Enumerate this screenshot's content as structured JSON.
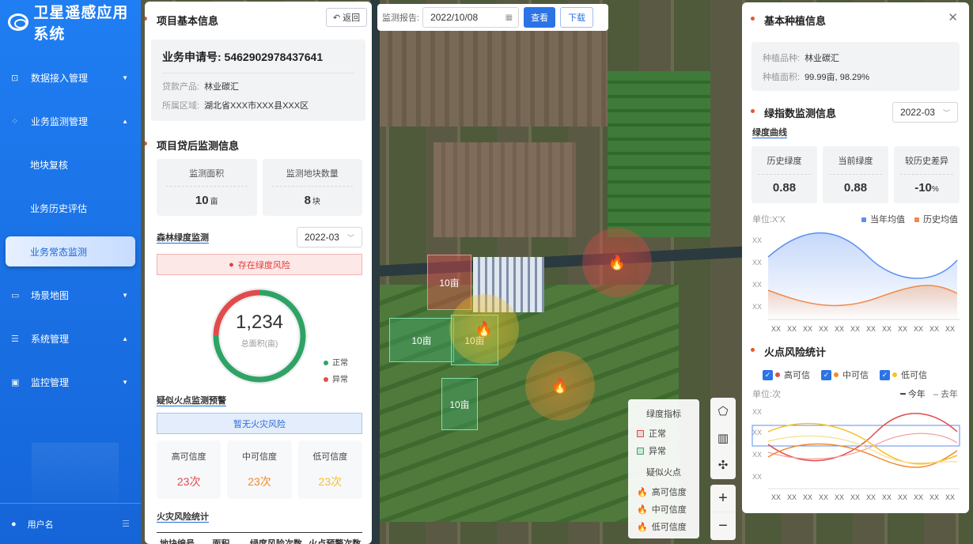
{
  "app": {
    "title": "卫星遥感应用系统"
  },
  "sidebar": {
    "items": [
      {
        "label": "数据接入管理",
        "icon": "data-import-icon",
        "caret": "▼"
      },
      {
        "label": "业务监测管理",
        "icon": "grid-icon",
        "caret": "▲"
      }
    ],
    "sub": [
      "地块复核",
      "业务历史评估",
      "业务常态监测"
    ],
    "items2": [
      {
        "label": "场景地图",
        "icon": "map-icon",
        "caret": "▼"
      },
      {
        "label": "系统管理",
        "icon": "settings-icon",
        "caret": "▲"
      },
      {
        "label": "监控管理",
        "icon": "monitor-icon",
        "caret": "▼"
      }
    ],
    "user": "用户名"
  },
  "topbar": {
    "label": "监测报告:",
    "date": "2022/10/08",
    "view_btn": "查看",
    "download_btn": "下载"
  },
  "left": {
    "title": "项目基本信息",
    "back": "返回",
    "app_no": "业务申请号: 5462902978437641",
    "product_label": "贷款产品:",
    "product": "林业碳汇",
    "region_label": "所属区域:",
    "region": "湖北省XXX市XXX县XXX区",
    "monitor_title": "项目贷后监测信息",
    "area_label": "监测面积",
    "area_value": "10",
    "area_unit": "亩",
    "count_label": "监测地块数量",
    "count_value": "8",
    "count_unit": "块",
    "forest_title": "森林绿度监测",
    "forest_month": "2022-03",
    "risk_alert": "存在绿度风险",
    "donut_value": "1,234",
    "donut_label": "总面积(亩)",
    "legend_normal": "正常",
    "legend_abnormal": "异常",
    "fire_title": "疑似火点监测预警",
    "fire_alert": "暂无火灾风险",
    "conf": [
      {
        "label": "高可信度",
        "value": "23次",
        "color": "#e14b4b"
      },
      {
        "label": "中可信度",
        "value": "23次",
        "color": "#f08a2f"
      },
      {
        "label": "低可信度",
        "value": "23次",
        "color": "#f5c22b"
      }
    ],
    "fire_stats_title": "火灾风险统计",
    "table_headers": [
      "地块编号",
      "面积",
      "绿度风险次数",
      "火点预警次数"
    ]
  },
  "right": {
    "title": "基本种植信息",
    "crop_label": "种植品种:",
    "crop": "林业碳汇",
    "area_label": "种植面积:",
    "area": "99.99亩, 98.29%",
    "green_title": "绿指数监测信息",
    "green_month": "2022-03",
    "curve_title": "绿度曲线",
    "stats": [
      {
        "label": "历史绿度",
        "value": "0.88",
        "unit": ""
      },
      {
        "label": "当前绿度",
        "value": "0.88",
        "unit": ""
      },
      {
        "label": "较历史差异",
        "value": "-10",
        "unit": "%"
      }
    ],
    "unit1": "单位:X'X",
    "legend_cur": "当年均值",
    "legend_hist": "历史均值",
    "y_tick": "XX",
    "x_tick": "XX",
    "fire_title": "火点风险统计",
    "fire_checks": [
      "高可信",
      "中可信",
      "低可信"
    ],
    "unit2": "单位:次",
    "legend_this": "今年",
    "legend_last": "去年"
  },
  "map": {
    "parcel_label": "10亩",
    "legend_green": "绿度指标",
    "legend_normal": "正常",
    "legend_abnormal": "异常",
    "legend_fire": "疑似火点",
    "legend_high": "高可信度",
    "legend_mid": "中可信度",
    "legend_low": "低可信度",
    "zoom_in": "+",
    "zoom_out": "−"
  },
  "colors": {
    "primary": "#2c73e6",
    "danger": "#e03b3b",
    "orange": "#f08a2f",
    "yellow": "#f5c22b",
    "normal": "#3aa86b",
    "abnormal": "#e14b4b"
  }
}
